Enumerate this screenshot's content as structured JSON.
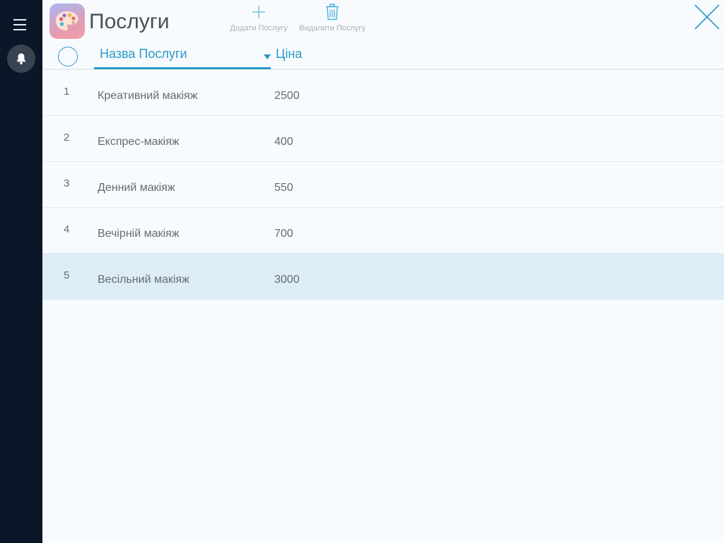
{
  "header": {
    "title": "Послуги",
    "add_label": "Додати Послугу",
    "delete_label": "Видалити Послугу"
  },
  "columns": {
    "name": "Назва Послуги",
    "price": "Ціна"
  },
  "rows": [
    {
      "num": "1",
      "name": "Креативний макіяж",
      "price": "2500",
      "selected": false
    },
    {
      "num": "2",
      "name": "Експрес-макіяж",
      "price": "400",
      "selected": false
    },
    {
      "num": "3",
      "name": "Денний макіяж",
      "price": "550",
      "selected": false
    },
    {
      "num": "4",
      "name": "Вечірній макіяж",
      "price": "700",
      "selected": false
    },
    {
      "num": "5",
      "name": "Весільний макіяж",
      "price": "3000",
      "selected": true
    }
  ],
  "icons": {
    "menu": "hamburger-menu-icon",
    "notifications": "bell-icon",
    "app": "palette-icon",
    "add": "plus-icon",
    "delete": "trash-icon",
    "close": "close-icon"
  },
  "colors": {
    "accent": "#2a9ac8",
    "sidebar": "#0b1628",
    "selected_row": "#ddedf8"
  }
}
